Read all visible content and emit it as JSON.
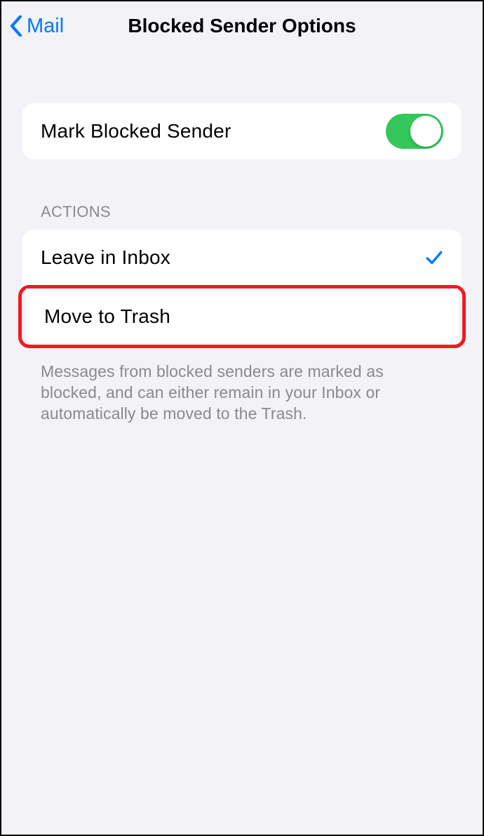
{
  "nav": {
    "back_label": "Mail",
    "title": "Blocked Sender Options"
  },
  "toggle_row": {
    "label": "Mark Blocked Sender",
    "on": true
  },
  "actions": {
    "header": "ACTIONS",
    "items": [
      {
        "label": "Leave in Inbox",
        "selected": true,
        "highlighted": false
      },
      {
        "label": "Move to Trash",
        "selected": false,
        "highlighted": true
      }
    ],
    "footer": "Messages from blocked senders are marked as blocked, and can either remain in your Inbox or automatically be moved to the Trash."
  }
}
